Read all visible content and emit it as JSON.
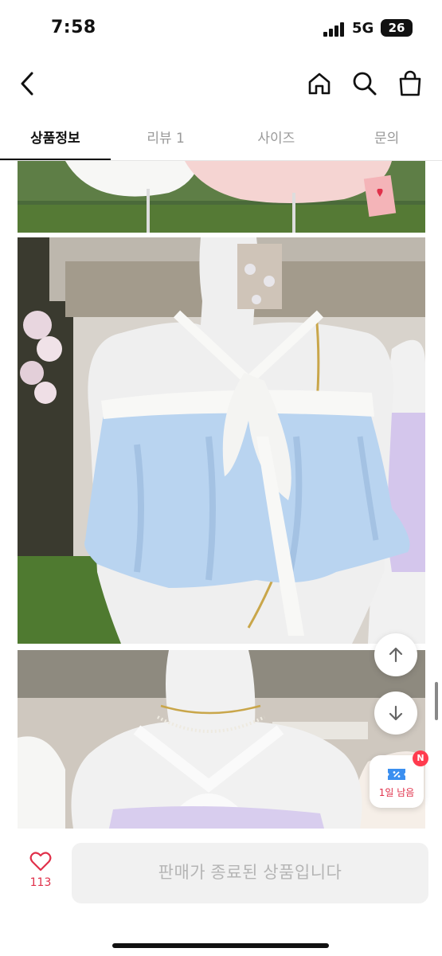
{
  "status": {
    "time": "7:58",
    "network": "5G",
    "battery": "26"
  },
  "header": {
    "back_icon": "chevron-left-icon",
    "home_icon": "home-icon",
    "search_icon": "search-icon",
    "bag_icon": "shopping-bag-icon"
  },
  "tabs": [
    {
      "label": "상품정보",
      "active": true
    },
    {
      "label": "리뷰 1",
      "active": false
    },
    {
      "label": "사이즈",
      "active": false
    },
    {
      "label": "문의",
      "active": false
    }
  ],
  "photos": [
    {
      "name": "white-pink-blouses-photo"
    },
    {
      "name": "blue-halter-top-photo"
    },
    {
      "name": "lavender-halter-top-photo"
    }
  ],
  "floating": {
    "scroll_up_icon": "arrow-up-icon",
    "scroll_down_icon": "arrow-down-icon",
    "coupon": {
      "badge": "N",
      "label": "1일 남음",
      "icon": "coupon-icon"
    }
  },
  "bottom": {
    "like_count": "113",
    "like_icon": "heart-icon",
    "buy_label": "판매가 종료된 상품입니다"
  },
  "colors": {
    "accent": "#e0304a",
    "disabled_bg": "#f1f1f1",
    "disabled_text": "#b5b5b5"
  }
}
